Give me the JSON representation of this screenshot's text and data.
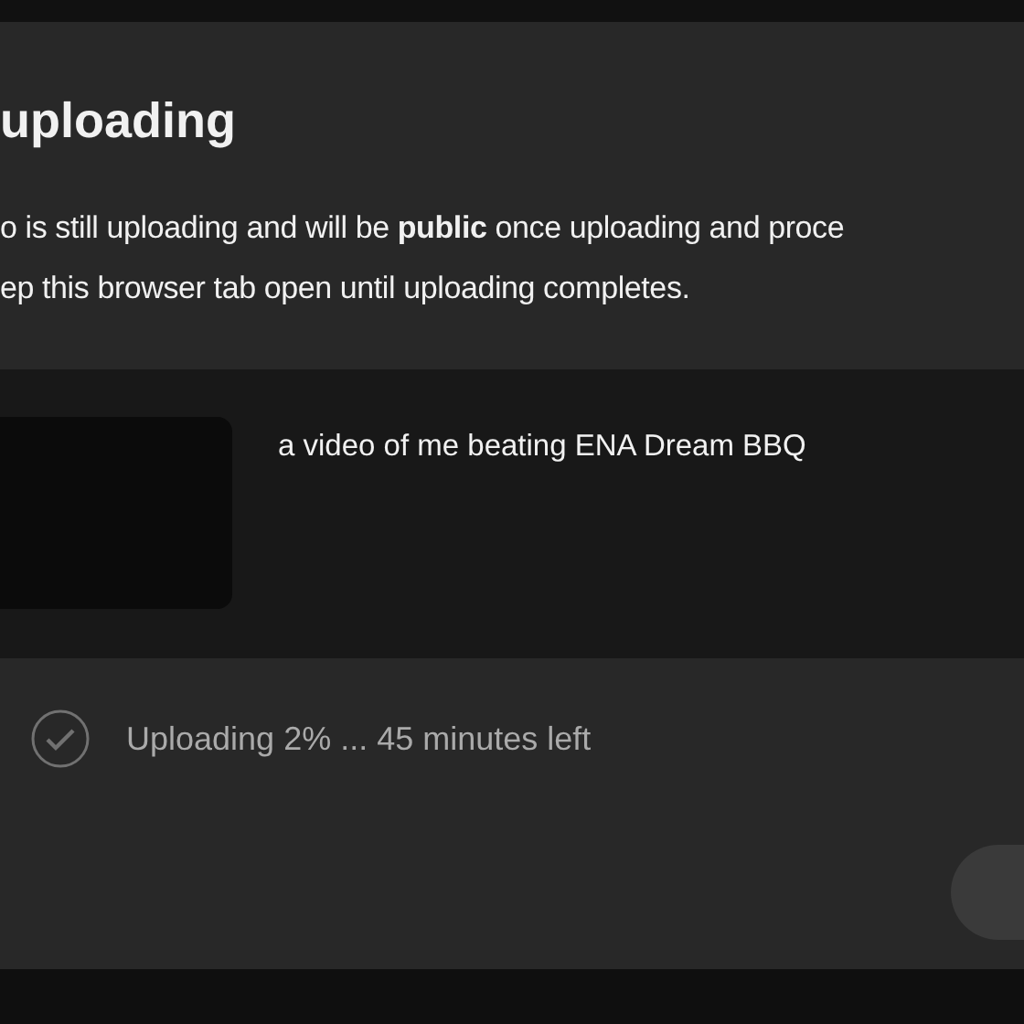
{
  "dialog": {
    "title": "uploading",
    "message": [
      "o is still uploading and will be **public** once uploading and proce",
      "ep this browser tab open until uploading completes."
    ]
  },
  "video": {
    "title": "a video of me beating ENA Dream BBQ"
  },
  "upload": {
    "status": "Uploading 2% ... 45 minutes left"
  }
}
